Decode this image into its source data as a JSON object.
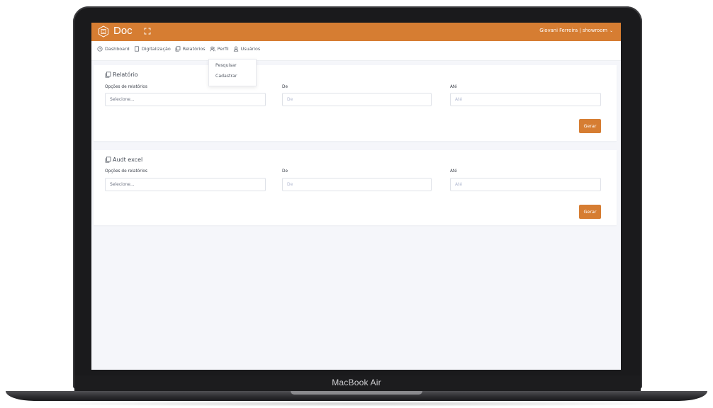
{
  "device": {
    "label": "MacBook Air"
  },
  "topbar": {
    "brand": "Doc",
    "user": "Giovani Ferreira | showroom",
    "user_chevron": "⌄"
  },
  "nav": {
    "items": [
      {
        "label": "Dashboard",
        "icon": "clock-icon"
      },
      {
        "label": "Digitalização",
        "icon": "book-icon"
      },
      {
        "label": "Relatórios",
        "icon": "copy-icon"
      },
      {
        "label": "Perfil",
        "icon": "users-icon"
      },
      {
        "label": "Usuários",
        "icon": "user-icon"
      }
    ],
    "dropdown": [
      "Pesquisar",
      "Cadastrar"
    ]
  },
  "cards": [
    {
      "title": "Relatório",
      "options_label": "Opções de relatórios",
      "select_value": "Selecione...",
      "from_label": "De",
      "from_placeholder": "De",
      "to_label": "Até",
      "to_placeholder": "Até",
      "button": "Gerar"
    },
    {
      "title": "Audt excel",
      "options_label": "Opções de relatórios",
      "select_value": "Selecione...",
      "from_label": "De",
      "from_placeholder": "De",
      "to_label": "Até",
      "to_placeholder": "Até",
      "button": "Gerar"
    }
  ],
  "colors": {
    "accent": "#d67d32",
    "background": "#f5f6fa"
  }
}
